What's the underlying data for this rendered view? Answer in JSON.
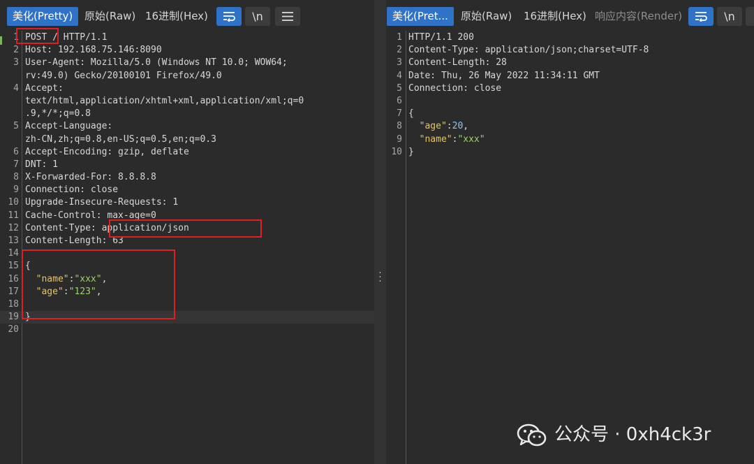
{
  "left_pane": {
    "tabs": [
      "美化(Pretty)",
      "原始(Raw)",
      "16进制(Hex)"
    ],
    "newline_label": "\\n",
    "lines": [
      {
        "n": "1",
        "parts": [
          [
            "p",
            "POST / HTTP/1.1"
          ]
        ]
      },
      {
        "n": "2",
        "parts": [
          [
            "p",
            "Host: 192.168.75.146:8090"
          ]
        ]
      },
      {
        "n": "3",
        "parts": [
          [
            "p",
            "User-Agent: Mozilla/5.0 (Windows NT 10.0; WOW64;"
          ]
        ]
      },
      {
        "n": "",
        "parts": [
          [
            "p",
            "rv:49.0) Gecko/20100101 Firefox/49.0"
          ]
        ]
      },
      {
        "n": "4",
        "parts": [
          [
            "p",
            "Accept:"
          ]
        ]
      },
      {
        "n": "",
        "parts": [
          [
            "p",
            "text/html,application/xhtml+xml,application/xml;q=0"
          ]
        ]
      },
      {
        "n": "",
        "parts": [
          [
            "p",
            ".9,*/*;q=0.8"
          ]
        ]
      },
      {
        "n": "5",
        "parts": [
          [
            "p",
            "Accept-Language:"
          ]
        ]
      },
      {
        "n": "",
        "parts": [
          [
            "p",
            "zh-CN,zh;q=0.8,en-US;q=0.5,en;q=0.3"
          ]
        ]
      },
      {
        "n": "6",
        "parts": [
          [
            "p",
            "Accept-Encoding: gzip, deflate"
          ]
        ]
      },
      {
        "n": "7",
        "parts": [
          [
            "p",
            "DNT: 1"
          ]
        ]
      },
      {
        "n": "8",
        "parts": [
          [
            "p",
            "X-Forwarded-For: 8.8.8.8"
          ]
        ]
      },
      {
        "n": "9",
        "parts": [
          [
            "p",
            "Connection: close"
          ]
        ]
      },
      {
        "n": "10",
        "parts": [
          [
            "p",
            "Upgrade-Insecure-Requests: 1"
          ]
        ]
      },
      {
        "n": "11",
        "parts": [
          [
            "p",
            "Cache-Control: max-age=0"
          ]
        ]
      },
      {
        "n": "12",
        "parts": [
          [
            "p",
            "Content-Type: application/json"
          ]
        ]
      },
      {
        "n": "13",
        "parts": [
          [
            "p",
            "Content-Length: 63"
          ]
        ]
      },
      {
        "n": "14",
        "parts": []
      },
      {
        "n": "15",
        "parts": [
          [
            "p",
            "{"
          ]
        ]
      },
      {
        "n": "16",
        "parts": [
          [
            "p",
            "  "
          ],
          [
            "k",
            "\"name\""
          ],
          [
            "p",
            ":"
          ],
          [
            "s",
            "\"xxx\""
          ],
          [
            "p",
            ","
          ]
        ]
      },
      {
        "n": "17",
        "parts": [
          [
            "p",
            "  "
          ],
          [
            "k",
            "\"age\""
          ],
          [
            "p",
            ":"
          ],
          [
            "s",
            "\"123\""
          ],
          [
            "p",
            ","
          ]
        ]
      },
      {
        "n": "18",
        "parts": []
      },
      {
        "n": "19",
        "parts": [
          [
            "p",
            "}"
          ]
        ],
        "hl": true
      },
      {
        "n": "20",
        "parts": []
      }
    ]
  },
  "right_pane": {
    "tabs": [
      "美化(Pret...",
      "原始(Raw)",
      "16进制(Hex)",
      "响应内容(Render)"
    ],
    "newline_label": "\\n",
    "lines": [
      {
        "n": "1",
        "parts": [
          [
            "p",
            "HTTP/1.1 200"
          ]
        ]
      },
      {
        "n": "2",
        "parts": [
          [
            "p",
            "Content-Type: application/json;charset=UTF-8"
          ]
        ]
      },
      {
        "n": "3",
        "parts": [
          [
            "p",
            "Content-Length: 28"
          ]
        ]
      },
      {
        "n": "4",
        "parts": [
          [
            "p",
            "Date: Thu, 26 May 2022 11:34:11 GMT"
          ]
        ]
      },
      {
        "n": "5",
        "parts": [
          [
            "p",
            "Connection: close"
          ]
        ]
      },
      {
        "n": "6",
        "parts": []
      },
      {
        "n": "7",
        "parts": [
          [
            "p",
            "{"
          ]
        ]
      },
      {
        "n": "8",
        "parts": [
          [
            "p",
            "  "
          ],
          [
            "k",
            "\"age\""
          ],
          [
            "p",
            ":"
          ],
          [
            "n",
            "20"
          ],
          [
            "p",
            ","
          ]
        ]
      },
      {
        "n": "9",
        "parts": [
          [
            "p",
            "  "
          ],
          [
            "k",
            "\"name\""
          ],
          [
            "p",
            ":"
          ],
          [
            "s",
            "\"xxx\""
          ]
        ]
      },
      {
        "n": "10",
        "parts": [
          [
            "p",
            "}"
          ]
        ]
      }
    ]
  },
  "watermark": {
    "text": "公众号 · 0xh4ck3r"
  },
  "colors": {
    "accent": "#2e73c8",
    "background": "#2b2b2b",
    "highlight_box": "#e02020",
    "json_key": "#e3c56a",
    "json_string": "#9dd46a",
    "json_number": "#8cc4f5"
  }
}
